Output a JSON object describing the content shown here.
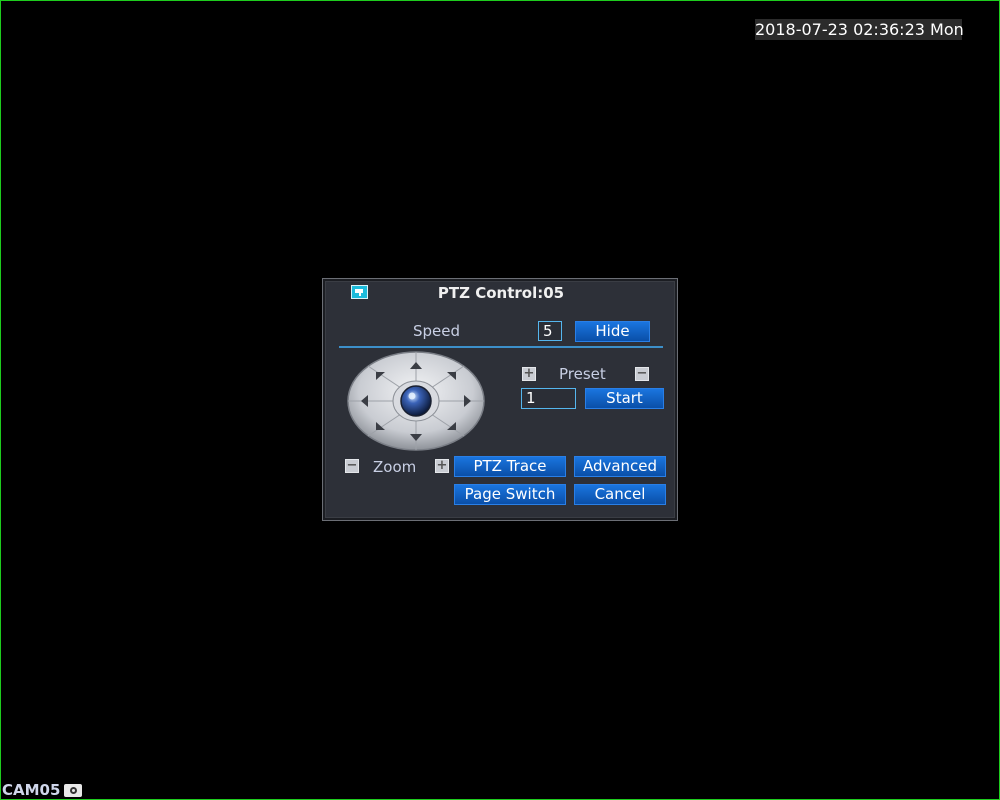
{
  "overlay": {
    "timestamp": "2018-07-23 02:36:23 Mon",
    "camera_label": "CAM05"
  },
  "dialog": {
    "title": "PTZ Control:05",
    "speed": {
      "label": "Speed",
      "value": "5"
    },
    "hide_label": "Hide",
    "preset": {
      "label": "Preset",
      "value": "1",
      "plus": "+",
      "minus": "−"
    },
    "start_label": "Start",
    "zoom": {
      "label": "Zoom",
      "plus": "+",
      "minus": "−"
    },
    "buttons": {
      "ptz_trace": "PTZ Trace",
      "advanced": "Advanced",
      "page_switch": "Page Switch",
      "cancel": "Cancel"
    }
  },
  "colors": {
    "frame_border": "#1ecc1e",
    "button": "#0f5fc4",
    "dialog_bg": "#2d3038",
    "accent_line": "#3c8fc9"
  },
  "icons": [
    "ptz-camera-icon",
    "snapshot-icon",
    "joystick-up-icon",
    "joystick-down-icon",
    "joystick-left-icon",
    "joystick-right-icon",
    "camera-lens-icon"
  ]
}
